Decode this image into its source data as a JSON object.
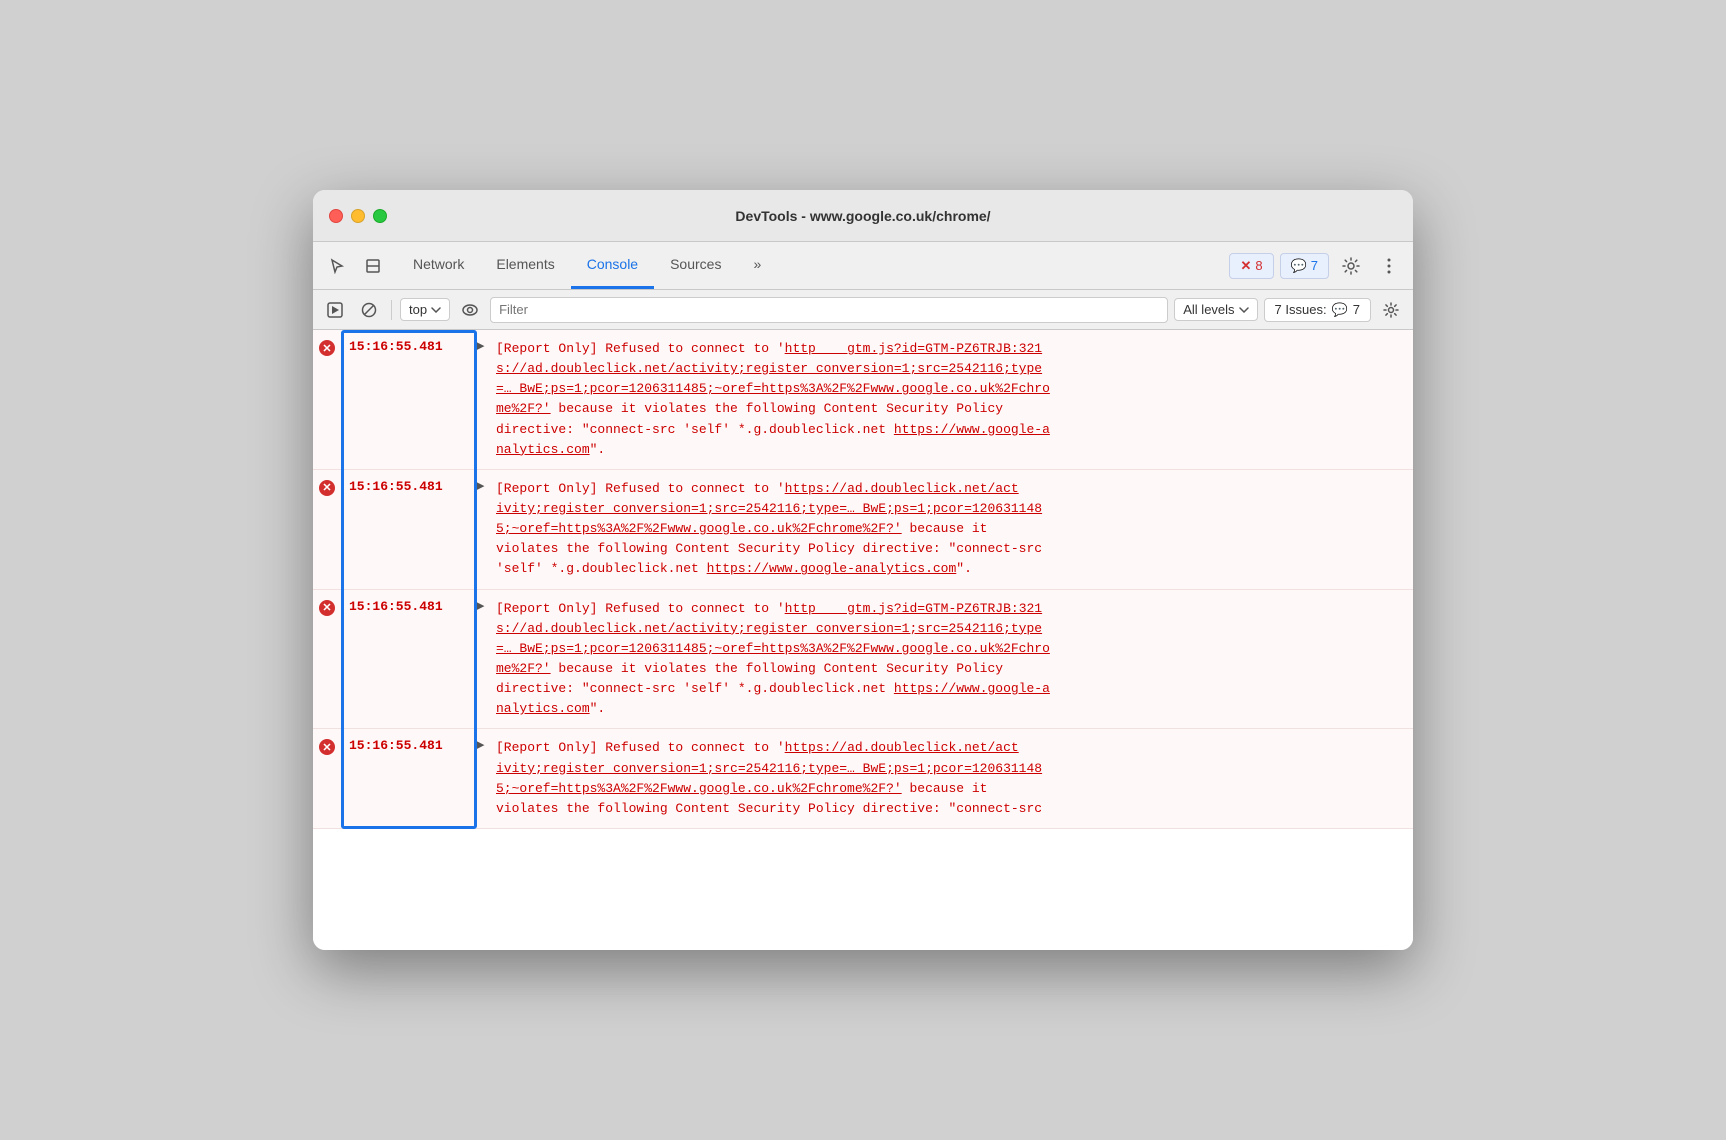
{
  "window": {
    "title": "DevTools - www.google.co.uk/chrome/"
  },
  "tabs": {
    "items": [
      {
        "id": "cursor",
        "label": ""
      },
      {
        "id": "elements-icon",
        "label": ""
      },
      {
        "id": "network",
        "label": "Network"
      },
      {
        "id": "elements",
        "label": "Elements"
      },
      {
        "id": "console",
        "label": "Console"
      },
      {
        "id": "sources",
        "label": "Sources"
      },
      {
        "id": "more",
        "label": "»"
      }
    ],
    "active": "console"
  },
  "toolbar_right": {
    "errors_count": "8",
    "messages_count": "7",
    "errors_label": "8",
    "messages_label": "7"
  },
  "console_toolbar": {
    "filter_placeholder": "Filter",
    "top_label": "top",
    "levels_label": "All levels",
    "issues_label": "7 Issues:",
    "issues_count": "7"
  },
  "log_entries": [
    {
      "id": 1,
      "timestamp": "15:16:55.481",
      "source": "gtm.js?id=GTM-PZ6TRJB:321",
      "message": "[Report Only] Refused to connect to 'https://ad.doubleclick.net/activity;register_conversion=1;src=2542116;type=… BwE;ps=1;pcor=1206311485;~oref=https%3A%2F%2Fwww.google.co.uk%2Fchrome%2F?' because it violates the following Content Security Policy directive: \"connect-src 'self' *.g.doubleclick.net https://www.google-analytics.com\"."
    },
    {
      "id": 2,
      "timestamp": "15:16:55.481",
      "source": "",
      "message": "[Report Only] Refused to connect to 'https://ad.doubleclick.net/activity;register_conversion=1;src=2542116;type=… BwE;ps=1;pcor=1206311485;~oref=https%3A%2F%2Fwww.google.co.uk%2Fchrome%2F?' because it violates the following Content Security Policy directive: \"connect-src 'self' *.g.doubleclick.net https://www.google-analytics.com\"."
    },
    {
      "id": 3,
      "timestamp": "15:16:55.481",
      "source": "gtm.js?id=GTM-PZ6TRJB:321",
      "message": "[Report Only] Refused to connect to 'https://ad.doubleclick.net/activity;register_conversion=1;src=2542116;type=… BwE;ps=1;pcor=1206311485;~oref=https%3A%2F%2Fwww.google.co.uk%2Fchrome%2F?' because it violates the following Content Security Policy directive: \"connect-src 'self' *.g.doubleclick.net https://www.google-analytics.com\"."
    },
    {
      "id": 4,
      "timestamp": "15:16:55.481",
      "source": "",
      "message": "[Report Only] Refused to connect to 'https://ad.doubleclick.net/activity;register_conversion=1;src=2542116;type=… BwE;ps=1;pcor=1206311485;~oref=https%3A%2F%2Fwww.google.co.uk%2Fchrome%2F?' because it violates the following Content Security Policy directive: \"connect-src 'self' *.g.doubleclick.net https://www.google-analytics.com\"."
    }
  ]
}
